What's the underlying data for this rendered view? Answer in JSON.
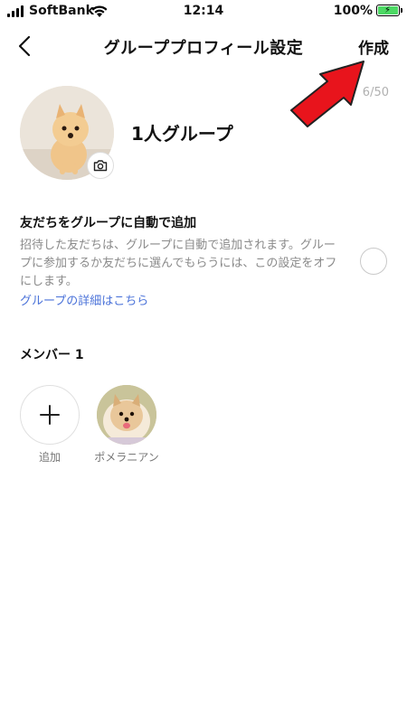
{
  "status_bar": {
    "carrier": "SoftBank",
    "time": "12:14",
    "battery": "100%",
    "battery_level": 1.0,
    "icons": [
      "signal-icon",
      "wifi-icon",
      "battery-icon"
    ]
  },
  "header": {
    "back_icon": "chevron-left-icon",
    "title": "グループプロフィール設定",
    "create_label": "作成"
  },
  "profile": {
    "char_count": "6/50",
    "group_name": "1人グループ",
    "camera_icon": "camera-icon"
  },
  "auto_add": {
    "title": "友だちをグループに自動で追加",
    "description": "招待した友だちは、グループに自動で追加されます。グループに参加するか友だちに選んでもらうには、この設定をオフにします。",
    "link": "グループの詳細はこちら",
    "enabled": false
  },
  "members": {
    "heading": "メンバー 1",
    "add_label": "追加",
    "items": [
      {
        "name": "ポメラニアン"
      }
    ]
  },
  "colors": {
    "link": "#4a72d9",
    "arrow": "#e8141c",
    "battery": "#4cd964"
  }
}
